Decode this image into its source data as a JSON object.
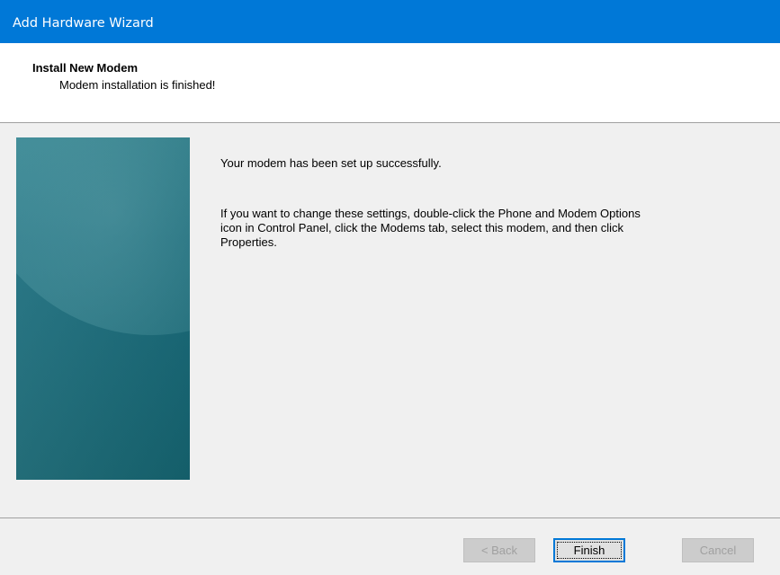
{
  "window": {
    "title": "Add Hardware Wizard"
  },
  "header": {
    "title": "Install New Modem",
    "subtitle": "Modem installation is finished!"
  },
  "body": {
    "message_1": "Your modem has been set up successfully.",
    "message_2": "If you want to change these settings, double-click the Phone and Modem Options icon in Control Panel, click the Modems tab, select this modem, and then click Properties."
  },
  "buttons": {
    "back": "< Back",
    "finish": "Finish",
    "cancel": "Cancel"
  },
  "colors": {
    "titlebar": "#0078d7",
    "side_panel": "#1d6f7f"
  }
}
